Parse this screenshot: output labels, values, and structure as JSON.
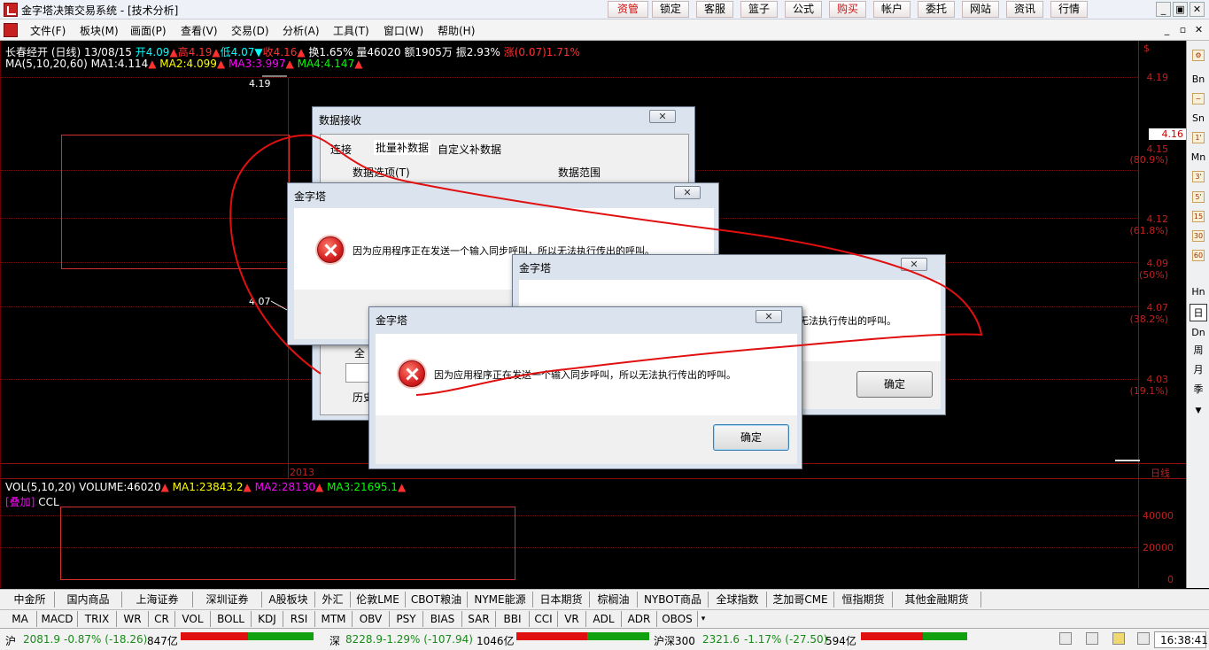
{
  "app": {
    "title": "金字塔决策交易系统 - [技术分析]",
    "toolbar_buttons": [
      "资管",
      "锁定",
      "客服",
      "篮子",
      "公式",
      "购买",
      "帐户",
      "委托",
      "网站",
      "资讯",
      "行情"
    ],
    "window_controls": [
      "_",
      "▣",
      "✕"
    ],
    "mdi_controls": [
      "_",
      "▫",
      "✕"
    ]
  },
  "menu": [
    "文件(F)",
    "板块(M)",
    "画面(P)",
    "查看(V)",
    "交易(D)",
    "分析(A)",
    "工具(T)",
    "窗口(W)",
    "帮助(H)"
  ],
  "chart": {
    "header_name": "长春经开 (日线) 13/08/15",
    "open": "开4.09",
    "high": "高4.19",
    "low": "低4.07",
    "close": "收4.16",
    "turnover": "换1.65%",
    "volume": "量46020",
    "amount": "额1905万",
    "amplitude": "振2.93%",
    "change": "涨(0.07)1.71%",
    "ma_label": "MA(5,10,20,60)",
    "ma1": "MA1:4.114",
    "ma2": "MA2:4.099",
    "ma3": "MA3:3.997",
    "ma4": "MA4:4.147",
    "high_mark": "4.19",
    "low_mark": "4.07",
    "year_label": "2013",
    "axis_prices": [
      "4.19",
      "4.15",
      "4.12",
      "4.09",
      "4.07",
      "4.03"
    ],
    "axis_pcts": [
      "(80.9%)",
      "(61.8%)",
      "(50%)",
      "(38.2%)",
      "(19.1%)"
    ],
    "current_price": "4.16",
    "period_label": "日线",
    "currency_icon": "$",
    "vol_label": "VOL(5,10,20)",
    "vol_value": "VOLUME:46020",
    "vol_ma1": "MA1:23843.2",
    "vol_ma2": "MA2:28130",
    "vol_ma3": "MA3:21695.1",
    "overlay_label": "[叠加]",
    "ccl_label": "CCL",
    "vol_axis": [
      "40000",
      "20000",
      "0"
    ],
    "colors": {
      "up": "#ff3030",
      "ma1": "#ffffff",
      "ma2": "#ffff00",
      "ma3": "#ff00ff",
      "ma4": "#00ff00",
      "grid": "#8b1010",
      "open": "#00ffff"
    }
  },
  "right_toolbar": [
    "Bn",
    "Sn",
    "Mn",
    "Hn",
    "日",
    "Dn",
    "周",
    "月",
    "季"
  ],
  "market_tabs": [
    "中金所",
    "国内商品",
    "上海证券",
    "深圳证券",
    "A股板块",
    "外汇",
    "伦敦LME",
    "CBOT粮油",
    "NYME能源",
    "日本期货",
    "棕榈油",
    "NYBOT商品",
    "全球指数",
    "芝加哥CME",
    "恒指期货",
    "其他金融期货"
  ],
  "indicator_tabs": [
    "MA",
    "MACD",
    "TRIX",
    "WR",
    "CR",
    "VOL",
    "BOLL",
    "KDJ",
    "RSI",
    "MTM",
    "OBV",
    "PSY",
    "BIAS",
    "SAR",
    "BBI",
    "CCI",
    "VR",
    "ADL",
    "ADR",
    "OBOS"
  ],
  "status": {
    "sh_label": "沪",
    "sh_value": "2081.9",
    "sh_change": "-0.87% (-18.26)",
    "sh_amount": "847亿",
    "sz_label": "深",
    "sz_value": "8228.9",
    "sz_change": "-1.29% (-107.94)",
    "sz_amount": "1046亿",
    "hs_label": "沪深300",
    "hs_value": "2321.6",
    "hs_change": "-1.17% (-27.50)",
    "hs_amount": "594亿",
    "time": "16:38:41"
  },
  "dialogs": {
    "data_receive": {
      "title": "数据接收",
      "tabs": [
        "连接",
        "批量补数据",
        "自定义补数据"
      ],
      "group1": "数据选项(T)",
      "group2": "数据范围",
      "btn_full": "全",
      "btn_history": "历史"
    },
    "error1": {
      "title": "金字塔",
      "message": "因为应用程序正在发送一个输入同步呼叫，所以无法执行传出的呼叫。"
    },
    "error2": {
      "title": "金字塔",
      "message": "无法执行传出的呼叫。",
      "ok": "确定"
    },
    "error3": {
      "title": "金字塔",
      "message": "因为应用程序正在发送一个输入同步呼叫，所以无法执行传出的呼叫。",
      "ok": "确定"
    }
  }
}
